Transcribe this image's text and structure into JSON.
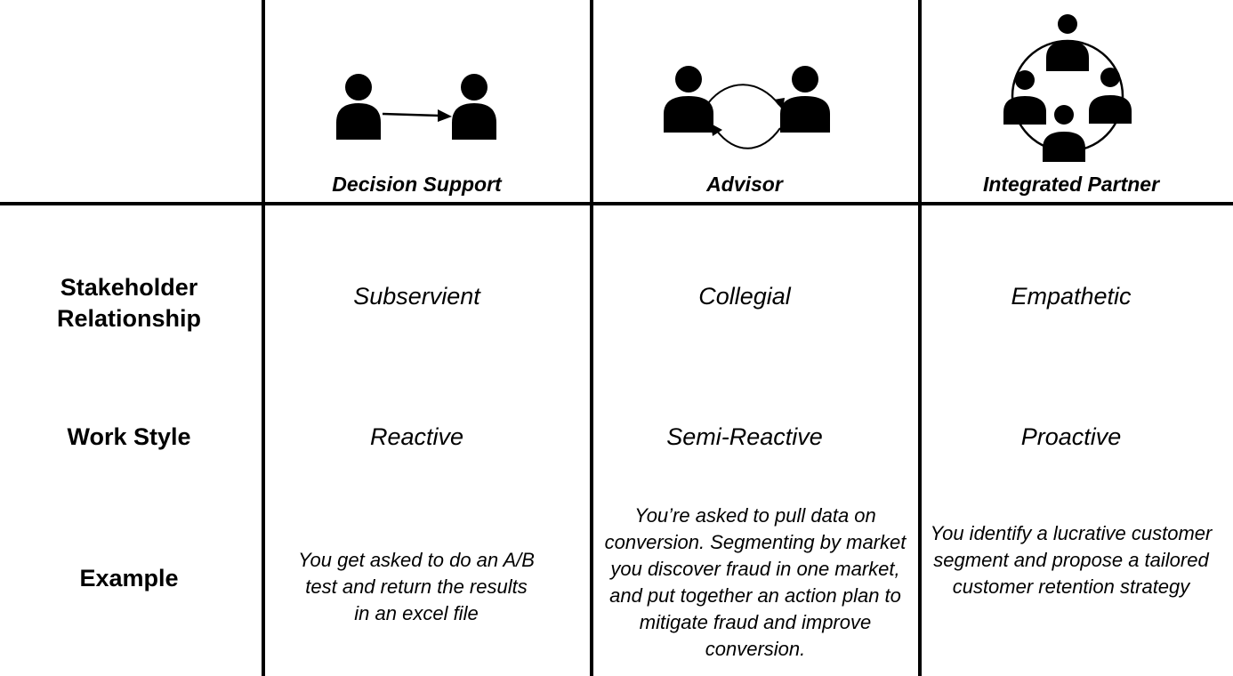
{
  "columns": [
    {
      "title": "Decision Support",
      "icon": "two-people-one-way-arrow-icon"
    },
    {
      "title": "Advisor",
      "icon": "two-people-two-way-arrows-icon"
    },
    {
      "title": "Integrated Partner",
      "icon": "four-people-circle-icon"
    }
  ],
  "rows": [
    {
      "label": "Stakeholder Relationship",
      "values": [
        "Subservient",
        "Collegial",
        "Empathetic"
      ]
    },
    {
      "label": "Work Style",
      "values": [
        "Reactive",
        "Semi-Reactive",
        "Proactive"
      ]
    },
    {
      "label": "Example",
      "values": [
        "You get asked to do an A/B test and return the results in an excel file",
        "You’re asked to pull data on conversion. Segmenting by market you discover fraud in one market, and put together an action plan to mitigate fraud and improve conversion.",
        "You identify a lucrative customer segment and propose a tailored customer retention strategy"
      ]
    }
  ]
}
